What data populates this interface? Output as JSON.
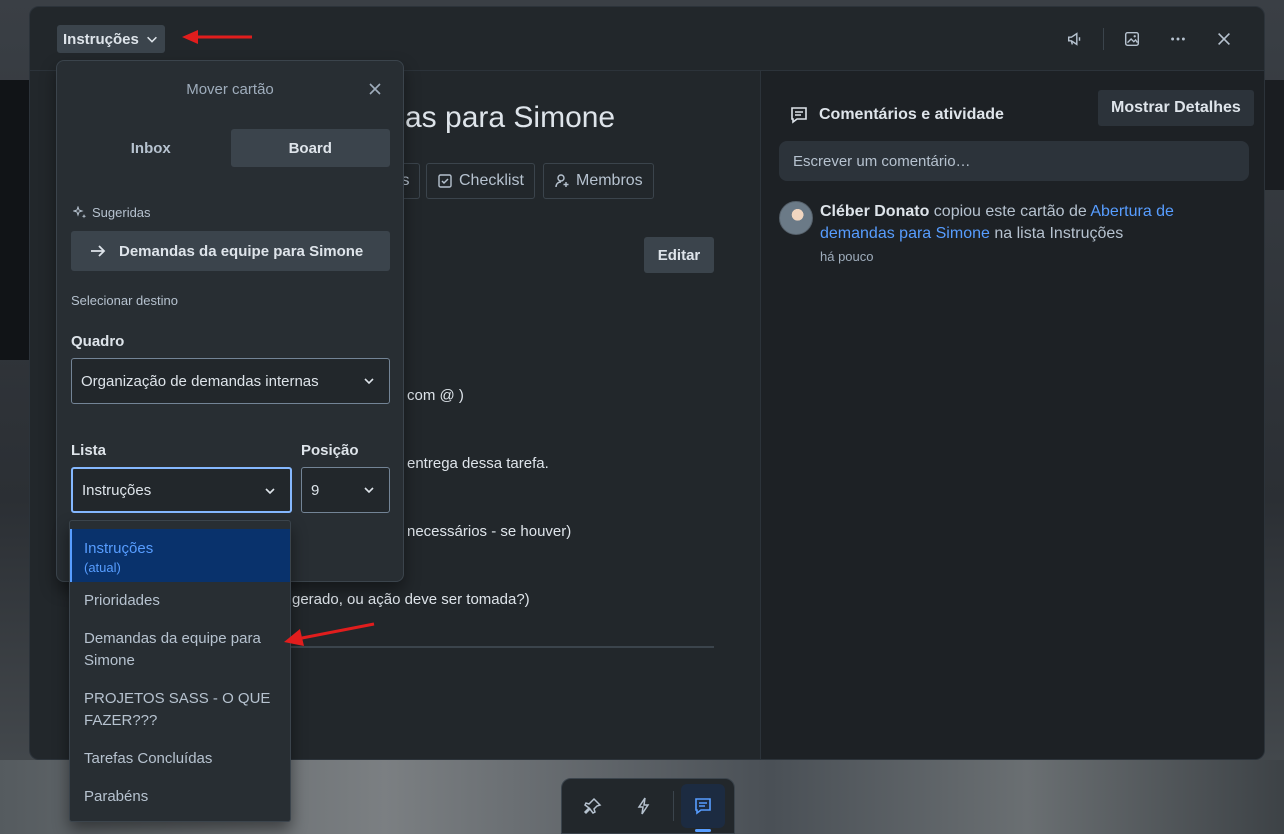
{
  "header": {
    "list_button_label": "Instruções"
  },
  "card": {
    "title": "as para Simone",
    "actions": [
      {
        "label": "s"
      },
      {
        "label": "Checklist"
      },
      {
        "label": "Membros"
      }
    ],
    "edit_label": "Editar",
    "description_lines": [
      "com @ )",
      "entrega dessa tarefa.",
      "necessários - se houver)",
      "gerado, ou ação deve ser tomada?)"
    ]
  },
  "sidebar": {
    "comments_title": "Comentários e atividade",
    "show_details_label": "Mostrar Detalhes",
    "comment_placeholder": "Escrever um comentário…",
    "activity": {
      "author": "Cléber Donato",
      "text_before": " copiou este cartão de ",
      "link_text": "Abertura de demandas para Simone",
      "text_after": " na lista Instruções",
      "time": "há pouco"
    }
  },
  "move_card": {
    "title": "Mover cartão",
    "tabs": [
      {
        "label": "Inbox",
        "active": false
      },
      {
        "label": "Board",
        "active": true
      }
    ],
    "suggested_label": "Sugeridas",
    "suggested_item": "Demandas da equipe para Simone",
    "select_destination_label": "Selecionar destino",
    "board_label": "Quadro",
    "board_value": "Organização de demandas internas",
    "list_label": "Lista",
    "list_value": "Instruções",
    "position_label": "Posição",
    "position_value": "9"
  },
  "list_options": [
    {
      "label": "Instruções",
      "sub": "(atual)",
      "selected": true
    },
    {
      "label": "Prioridades",
      "sub": "",
      "selected": false
    },
    {
      "label": "Demandas da equipe para Simone",
      "sub": "",
      "selected": false
    },
    {
      "label": "PROJETOS SASS - O QUE FAZER???",
      "sub": "",
      "selected": false
    },
    {
      "label": "Tarefas Concluídas",
      "sub": "",
      "selected": false
    },
    {
      "label": "Parabéns",
      "sub": "",
      "selected": false
    }
  ],
  "bottom_bar": {
    "icons": [
      "pin-icon",
      "lightning-icon",
      "chat-icon"
    ],
    "active": "chat-icon"
  },
  "colors": {
    "accent": "#579dff",
    "annotation_arrow": "#e11d1d",
    "surface": "#22272b"
  }
}
